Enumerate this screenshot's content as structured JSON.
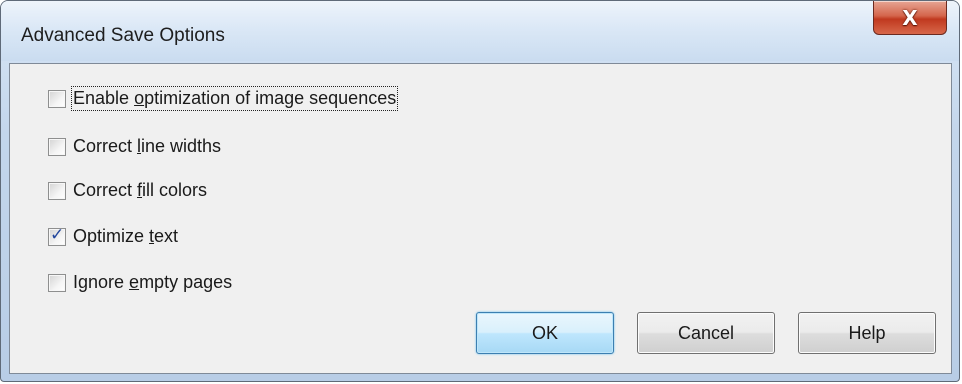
{
  "window": {
    "title": "Advanced Save Options",
    "close_glyph": "X"
  },
  "options": [
    {
      "pre": "Enable ",
      "accel": "o",
      "post": "ptimization of image sequences",
      "checked": false,
      "focused": true
    },
    {
      "pre": "Correct ",
      "accel": "l",
      "post": "ine widths",
      "checked": false,
      "focused": false
    },
    {
      "pre": "Correct ",
      "accel": "f",
      "post": "ill colors",
      "checked": false,
      "focused": false
    },
    {
      "pre": "Optimize ",
      "accel": "t",
      "post": "ext",
      "checked": true,
      "focused": false
    },
    {
      "pre": "Ignore ",
      "accel": "e",
      "post": "mpty pages",
      "checked": false,
      "focused": false
    }
  ],
  "buttons": {
    "ok": "OK",
    "cancel": "Cancel",
    "help": "Help"
  },
  "checkmark_glyph": "✓"
}
